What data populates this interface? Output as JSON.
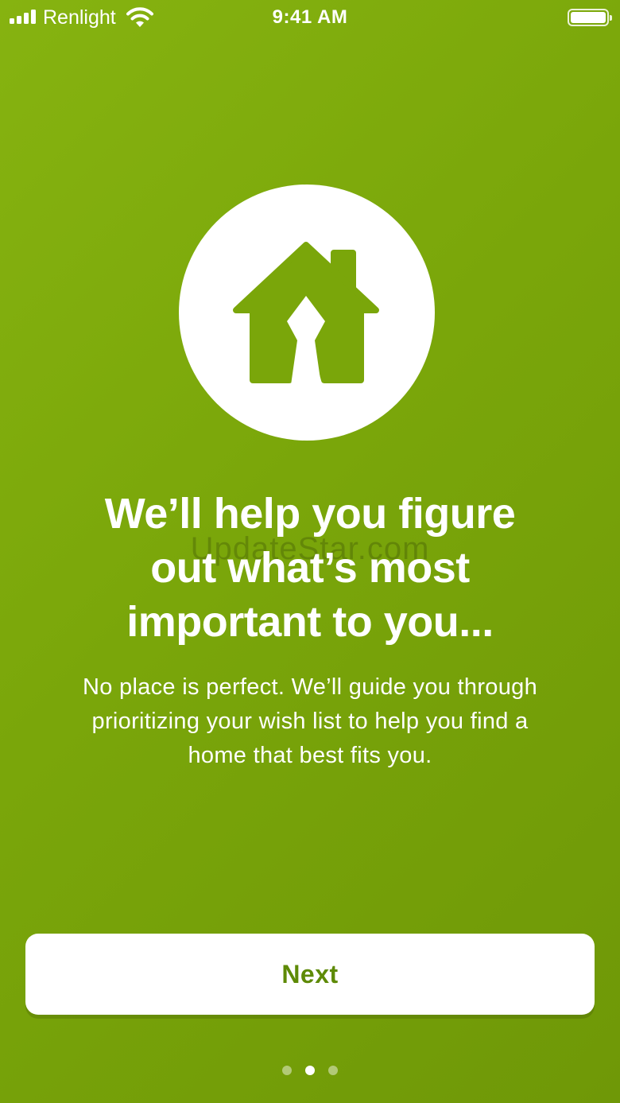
{
  "status_bar": {
    "carrier": "Renlight",
    "time": "9:41 AM"
  },
  "hero": {
    "icon": "house-icon"
  },
  "headline": {
    "line1": "We’ll help you figure",
    "line2": "out what’s most",
    "line3": "important to you..."
  },
  "watermark": "UpdateStar.com",
  "body": {
    "line1": "No place is perfect. We’ll guide you through",
    "line2": "prioritizing your wish list to help you find a",
    "line3": "home that best fits you."
  },
  "next_button": {
    "label": "Next"
  },
  "pagination": {
    "total": 3,
    "active_index": 1
  },
  "colors": {
    "background": "#7aa60a",
    "button_text": "#5e8a06",
    "icon": "#7aa60a"
  }
}
